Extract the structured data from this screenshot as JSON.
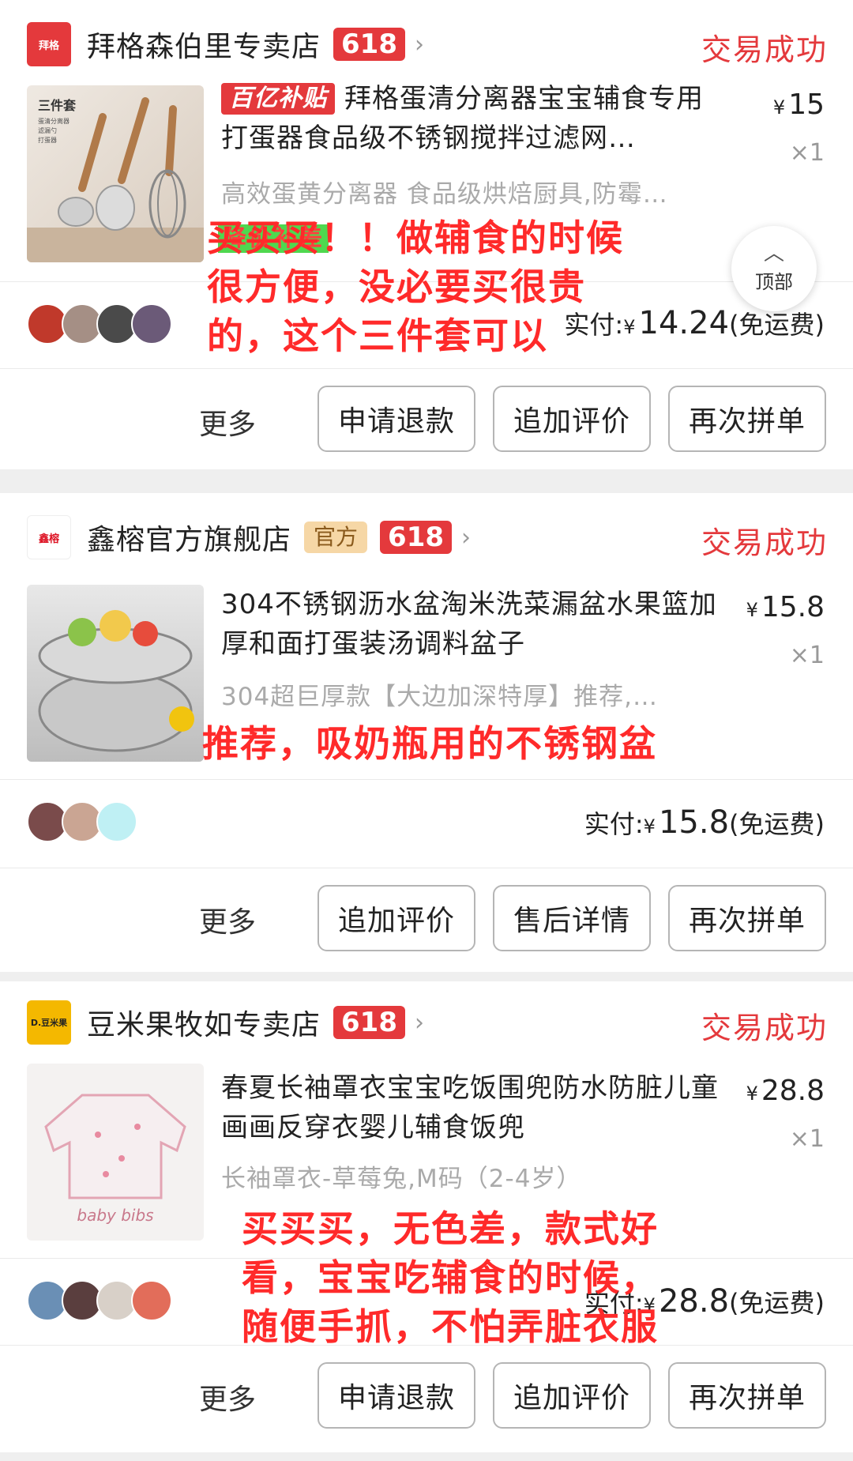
{
  "orders": [
    {
      "shop_name": "拜格森伯里专卖店",
      "shop_logo_text": "拜格",
      "tag_official": "",
      "tag_618": "618",
      "status": "交易成功",
      "badge": "百亿补贴",
      "title": "拜格蛋清分离器宝宝辅食专用打蛋器食品级不锈钢搅拌过滤网…",
      "spec": "高效蛋黄分离器 食品级烘焙厨具,防霉…",
      "price_symbol": "¥",
      "price": "15",
      "qty": "×1",
      "thumb_text": "三件套",
      "thumb_sub": [
        "蛋清分离器",
        "滤漏勺",
        "打蛋器"
      ],
      "paid_label": "实付:",
      "paid_symbol": "¥",
      "paid_amount": "14.24",
      "shipping": "(免运费)",
      "more": "更多",
      "buttons": [
        "申请退款",
        "追加评价",
        "再次拼单"
      ],
      "annotation_hl": "降价补差",
      "annotation": "买买买！！做辅食的时候很方便，没必要买很贵的，这个三件套可以"
    },
    {
      "shop_name": "鑫榕官方旗舰店",
      "shop_logo_text": "鑫榕",
      "tag_official": "官方",
      "tag_618": "618",
      "status": "交易成功",
      "title": "304不锈钢沥水盆淘米洗菜漏盆水果篮加厚和面打蛋装汤调料盆子",
      "spec": "304超巨厚款【大边加深特厚】推荐,…",
      "price_symbol": "¥",
      "price": "15.8",
      "qty": "×1",
      "paid_label": "实付:",
      "paid_symbol": "¥",
      "paid_amount": "15.8",
      "shipping": "(免运费)",
      "more": "更多",
      "buttons": [
        "追加评价",
        "售后详情",
        "再次拼单"
      ],
      "annotation": "推荐，吸奶瓶用的不锈钢盆"
    },
    {
      "shop_name": "豆米果牧如专卖店",
      "shop_logo_text": "D.豆米果",
      "tag_official": "",
      "tag_618": "618",
      "status": "交易成功",
      "title": "春夏长袖罩衣宝宝吃饭围兜防水防脏儿童画画反穿衣婴儿辅食饭兜",
      "spec": "长袖罩衣-草莓兔,M码（2-4岁）",
      "price_symbol": "¥",
      "price": "28.8",
      "qty": "×1",
      "thumb_text": "baby bibs",
      "paid_label": "实付:",
      "paid_symbol": "¥",
      "paid_amount": "28.8",
      "shipping": "(免运费)",
      "more": "更多",
      "buttons": [
        "申请退款",
        "追加评价",
        "再次拼单"
      ],
      "annotation": "买买买，无色差，款式好看，宝宝吃辅食的时候，随便手抓，不怕弄脏衣服"
    }
  ],
  "top_button": {
    "icon": "arrow-up-icon",
    "label": "顶部"
  },
  "colors": {
    "accent": "#e4393c",
    "annotation": "#ff2a2a",
    "official": "#f6d7a6"
  }
}
